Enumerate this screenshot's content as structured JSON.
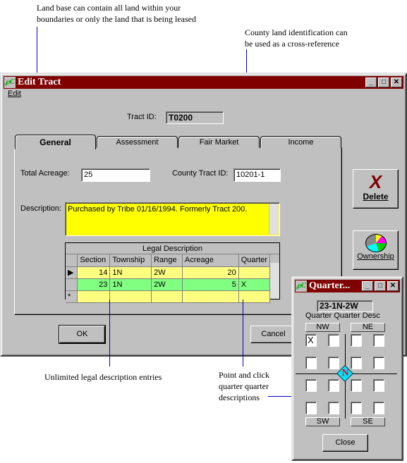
{
  "annotations": {
    "land_base": "Land base can contain all land within your\nboundaries or only the land that is being leased",
    "county": "County land identification can\nbe used as a cross-reference",
    "legal": "Unlimited legal description entries",
    "quarter": "Point and click\nquarter quarter\ndescriptions"
  },
  "window": {
    "title": "Edit Tract",
    "menu": [
      "Edit"
    ],
    "min": "_",
    "max": "□",
    "close": "✕"
  },
  "tract": {
    "label": "Tract ID:",
    "value": "T0200"
  },
  "tabs": [
    "General",
    "Assessment",
    "Fair Market",
    "Income"
  ],
  "general": {
    "acreage_label": "Total Acreage:",
    "acreage": "25",
    "county_label": "County Tract ID:",
    "county": "10201-1",
    "desc_label": "Description:",
    "desc": "Purchased by Tribe 01/16/1994.  Formerly Tract 200.",
    "desc_bg": "#ffff00"
  },
  "legal": {
    "title": "Legal Description",
    "columns": [
      "Section",
      "Township",
      "Range",
      "Acreage",
      "Quarter"
    ],
    "rows": [
      {
        "section": "14",
        "township": "1N",
        "range": "2W",
        "acreage": "20",
        "quarter": ""
      },
      {
        "section": "23",
        "township": "1N",
        "range": "2W",
        "acreage": "5",
        "quarter": "X"
      }
    ],
    "new_row_marker": "*"
  },
  "buttons": {
    "delete": "Delete",
    "ownership": "Ownership",
    "ok": "OK",
    "cancel": "Cancel"
  },
  "quarter": {
    "title": "Quarter...",
    "code": "23-1N-2W",
    "label": "Quarter Quarter Desc",
    "nw": "NW",
    "ne": "NE",
    "sw": "SW",
    "se": "SE",
    "close": "Close",
    "compass": "N",
    "checked": "X",
    "grid": [
      [
        "X",
        "",
        "",
        ""
      ],
      [
        "",
        "",
        "",
        ""
      ],
      [
        "",
        "",
        "",
        ""
      ],
      [
        "",
        "",
        "",
        ""
      ]
    ]
  }
}
